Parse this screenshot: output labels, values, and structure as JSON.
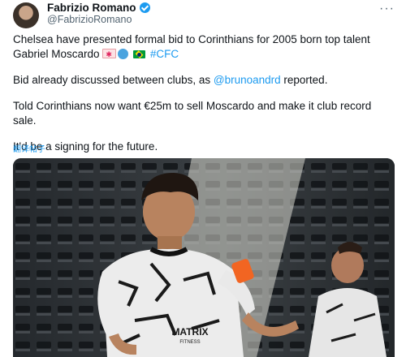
{
  "author": {
    "name": "Fabrizio Romano",
    "handle": "@FabrizioRomano"
  },
  "more_icon": "more-horizontal-icon",
  "tweet": {
    "line1": "Chelsea have presented formal bid to Corinthians for 2005 born top talent Gabriel Moscardo",
    "hashtag": "#CFC",
    "p2_before": "Bid already discussed between clubs, as ",
    "p2_mention": "@brunoandrd",
    "p2_after": " reported.",
    "p3": "Told Corinthians now want €25m to sell Moscardo and make it club record sale.",
    "p4": "It'd be a signing for the future."
  },
  "translate_label": "翻译帖子",
  "media": {
    "jersey_sponsor": "MATRIX",
    "jersey_sponsor_sub": "FITNESS"
  },
  "colors": {
    "link": "#1d9bf0",
    "verified": "#1d9bf0",
    "text": "#0f1419",
    "secondary": "#536471"
  }
}
